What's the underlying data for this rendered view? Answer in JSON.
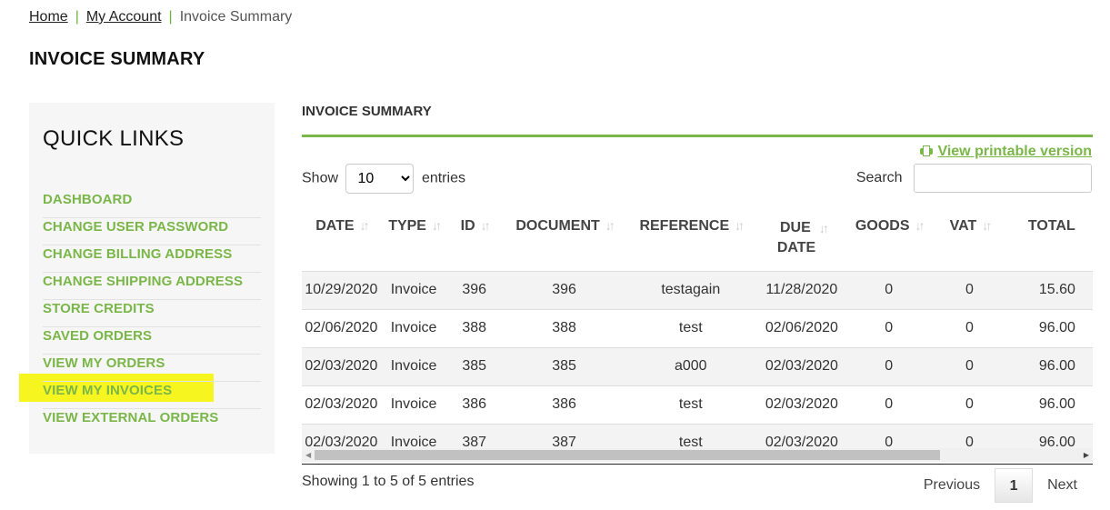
{
  "breadcrumb": {
    "home": "Home",
    "separator": "|",
    "account": "My Account",
    "current": "Invoice Summary"
  },
  "page_title": "INVOICE SUMMARY",
  "quick_links": {
    "title": "QUICK LINKS",
    "items": [
      {
        "label": "DASHBOARD"
      },
      {
        "label": "CHANGE USER PASSWORD"
      },
      {
        "label": "CHANGE BILLING ADDRESS"
      },
      {
        "label": "CHANGE SHIPPING ADDRESS"
      },
      {
        "label": "STORE CREDITS"
      },
      {
        "label": "SAVED ORDERS"
      },
      {
        "label": "VIEW MY ORDERS"
      },
      {
        "label": "VIEW MY INVOICES"
      },
      {
        "label": "VIEW EXTERNAL ORDERS"
      }
    ],
    "highlight_color": "#f7f520"
  },
  "section": {
    "title": "INVOICE SUMMARY",
    "print_link": "View printable version",
    "print_icon": "printer-icon"
  },
  "length_control": {
    "show_label": "Show",
    "selected": "10",
    "entries_label": "entries"
  },
  "search": {
    "label": "Search",
    "value": ""
  },
  "table": {
    "columns": [
      "DATE",
      "TYPE",
      "ID",
      "DOCUMENT",
      "REFERENCE",
      "DUE DATE",
      "GOODS",
      "VAT",
      "TOTAL"
    ],
    "rows": [
      [
        "10/29/2020",
        "Invoice",
        "396",
        "396",
        "testagain",
        "11/28/2020",
        "0",
        "0",
        "15.60"
      ],
      [
        "02/06/2020",
        "Invoice",
        "388",
        "388",
        "test",
        "02/06/2020",
        "0",
        "0",
        "96.00"
      ],
      [
        "02/03/2020",
        "Invoice",
        "385",
        "385",
        "a000",
        "02/03/2020",
        "0",
        "0",
        "96.00"
      ],
      [
        "02/03/2020",
        "Invoice",
        "386",
        "386",
        "test",
        "02/03/2020",
        "0",
        "0",
        "96.00"
      ],
      [
        "02/03/2020",
        "Invoice",
        "387",
        "387",
        "test",
        "02/03/2020",
        "0",
        "0",
        "96.00"
      ]
    ]
  },
  "footer": {
    "info": "Showing 1 to 5 of 5 entries",
    "previous": "Previous",
    "page": "1",
    "next": "Next"
  },
  "colors": {
    "accent": "#7ab648"
  }
}
